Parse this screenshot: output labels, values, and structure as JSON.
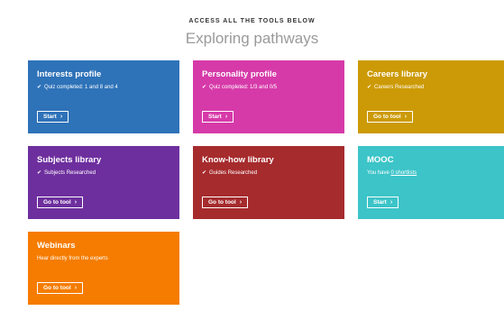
{
  "header": {
    "eyebrow": "ACCESS ALL THE TOOLS BELOW",
    "title": "Exploring pathways"
  },
  "cards": [
    {
      "title": "Interests profile",
      "sub": "Quiz completed: 1 and 8 and 4",
      "button": "Start",
      "color": "#2e72b8"
    },
    {
      "title": "Personality profile",
      "sub": "Quiz completed: 1/3 and 0/5",
      "button": "Start",
      "color": "#d63aa9"
    },
    {
      "title": "Careers library",
      "sub": "Careers Researched",
      "button": "Go to tool",
      "color": "#cc9a06"
    },
    {
      "title": "Subjects library",
      "sub": "Subjects Researched",
      "button": "Go to tool",
      "color": "#6e2f9e"
    },
    {
      "title": "Know-how library",
      "sub": "Guides Researched",
      "button": "Go to tool",
      "color": "#a62b2d"
    },
    {
      "title": "MOOC",
      "sub_prefix": "You have",
      "sub_link": "0 shortlists",
      "button": "Start",
      "color": "#3cc4c8"
    },
    {
      "title": "Webinars",
      "sub": "Hear directly from the experts",
      "button": "Go to tool",
      "color": "#f57c00"
    }
  ],
  "icons": {
    "check": "check-icon",
    "chevron": "chevron-right-icon"
  }
}
